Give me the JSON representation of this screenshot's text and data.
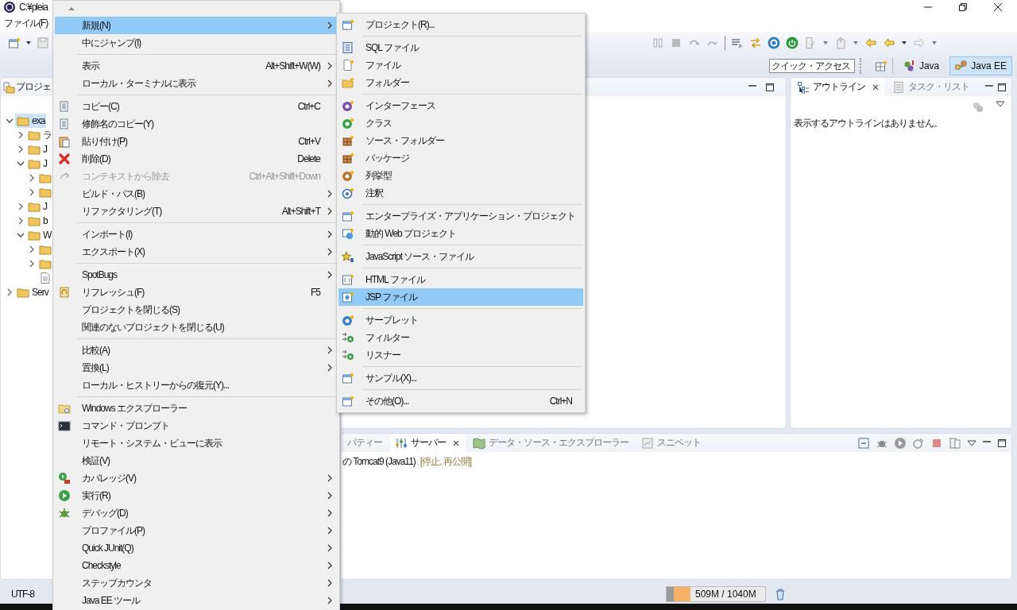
{
  "window": {
    "title": "C:¥pleia"
  },
  "menu_bar": [
    "ファイル(F)"
  ],
  "quick_access": {
    "placeholder": "クイック・アクセス"
  },
  "perspectives": [
    {
      "label": "Java",
      "selected": false
    },
    {
      "label": "Java EE",
      "selected": true
    }
  ],
  "project_explorer": {
    "title": "プロジェ",
    "tree": [
      {
        "label": "exa",
        "expanded": true,
        "selected": true,
        "children": [
          {
            "label": "ラ",
            "expanded": false,
            "selected": false
          },
          {
            "label": "J",
            "expanded": false,
            "selected": false
          },
          {
            "label": "J",
            "expanded": true,
            "selected": false,
            "children": [
              {
                "expanded": false,
                "selected": false
              },
              {
                "expanded": false,
                "selected": false
              }
            ]
          },
          {
            "label": "J",
            "expanded": false,
            "selected": false
          },
          {
            "label": "b",
            "expanded": false,
            "selected": false
          },
          {
            "label": "W",
            "expanded": true,
            "selected": false,
            "children": [
              {
                "expanded": false,
                "selected": false
              },
              {
                "expanded": false,
                "selected": false
              },
              {
                "selected": false
              }
            ]
          }
        ]
      },
      {
        "label": "Serv",
        "expanded": false,
        "selected": false
      }
    ]
  },
  "context_menu": {
    "items": [
      {
        "kind": "item",
        "label": "新規(N)",
        "submenu": true,
        "selected": true,
        "disabled": false
      },
      {
        "kind": "item",
        "label": "中にジャンプ(I)",
        "submenu": false,
        "selected": false,
        "disabled": false
      },
      {
        "kind": "separator"
      },
      {
        "kind": "item",
        "label": "表示",
        "shortcut": "Alt+Shift+W(W)",
        "submenu": true,
        "selected": false,
        "disabled": false
      },
      {
        "kind": "item",
        "label": "ローカル・ターミナルに表示",
        "submenu": true,
        "selected": false,
        "disabled": false
      },
      {
        "kind": "separator"
      },
      {
        "kind": "item",
        "label": "コピー(C)",
        "shortcut": "Ctrl+C",
        "submenu": false,
        "selected": false,
        "disabled": false
      },
      {
        "kind": "item",
        "label": "修飾名のコピー(Y)",
        "submenu": false,
        "selected": false,
        "disabled": false
      },
      {
        "kind": "item",
        "label": "貼り付け(P)",
        "shortcut": "Ctrl+V",
        "submenu": false,
        "selected": false,
        "disabled": false
      },
      {
        "kind": "item",
        "label": "削除(D)",
        "shortcut": "Delete",
        "submenu": false,
        "selected": false,
        "disabled": false
      },
      {
        "kind": "item",
        "label": "コンテキストから除去",
        "shortcut": "Ctrl+Alt+Shift+Down",
        "submenu": false,
        "selected": false,
        "disabled": true
      },
      {
        "kind": "item",
        "label": "ビルド・パス(B)",
        "submenu": true,
        "selected": false,
        "disabled": false
      },
      {
        "kind": "item",
        "label": "リファクタリング(T)",
        "shortcut": "Alt+Shift+T",
        "submenu": true,
        "selected": false,
        "disabled": false
      },
      {
        "kind": "separator"
      },
      {
        "kind": "item",
        "label": "インポート(I)",
        "submenu": true,
        "selected": false,
        "disabled": false
      },
      {
        "kind": "item",
        "label": "エクスポート(X)",
        "submenu": true,
        "selected": false,
        "disabled": false
      },
      {
        "kind": "separator"
      },
      {
        "kind": "item",
        "label": "SpotBugs",
        "submenu": true,
        "selected": false,
        "disabled": false
      },
      {
        "kind": "item",
        "label": "リフレッシュ(F)",
        "shortcut": "F5",
        "submenu": false,
        "selected": false,
        "disabled": false
      },
      {
        "kind": "item",
        "label": "プロジェクトを閉じる(S)",
        "submenu": false,
        "selected": false,
        "disabled": false
      },
      {
        "kind": "item",
        "label": "関連のないプロジェクトを閉じる(U)",
        "submenu": false,
        "selected": false,
        "disabled": false
      },
      {
        "kind": "separator"
      },
      {
        "kind": "item",
        "label": "比較(A)",
        "submenu": true,
        "selected": false,
        "disabled": false
      },
      {
        "kind": "item",
        "label": "置換(L)",
        "submenu": true,
        "selected": false,
        "disabled": false
      },
      {
        "kind": "item",
        "label": "ローカル・ヒストリーからの復元(Y)...",
        "submenu": false,
        "selected": false,
        "disabled": false
      },
      {
        "kind": "separator"
      },
      {
        "kind": "item",
        "label": "Windows エクスプローラー",
        "submenu": false,
        "selected": false,
        "disabled": false
      },
      {
        "kind": "item",
        "label": "コマンド・プロンプト",
        "submenu": false,
        "selected": false,
        "disabled": false
      },
      {
        "kind": "item",
        "label": "リモート・システム・ビューに表示",
        "submenu": false,
        "selected": false,
        "disabled": false
      },
      {
        "kind": "item",
        "label": "検証(V)",
        "submenu": false,
        "selected": false,
        "disabled": false
      },
      {
        "kind": "item",
        "label": "カバレッジ(V)",
        "submenu": true,
        "selected": false,
        "disabled": false
      },
      {
        "kind": "item",
        "label": "実行(R)",
        "submenu": true,
        "selected": false,
        "disabled": false
      },
      {
        "kind": "item",
        "label": "デバッグ(D)",
        "submenu": true,
        "selected": false,
        "disabled": false
      },
      {
        "kind": "item",
        "label": "プロファイル(P)",
        "submenu": true,
        "selected": false,
        "disabled": false
      },
      {
        "kind": "item",
        "label": "Quick JUnit(Q)",
        "submenu": true,
        "selected": false,
        "disabled": false
      },
      {
        "kind": "item",
        "label": "Checkstyle",
        "submenu": true,
        "selected": false,
        "disabled": false
      },
      {
        "kind": "item",
        "label": "ステップカウンタ",
        "submenu": true,
        "selected": false,
        "disabled": false
      },
      {
        "kind": "item",
        "label": "Java EE ツール",
        "submenu": true,
        "selected": false,
        "disabled": false
      }
    ]
  },
  "submenu": {
    "items": [
      {
        "kind": "item",
        "label": "プロジェクト(R)...",
        "selected": false
      },
      {
        "kind": "separator"
      },
      {
        "kind": "item",
        "label": "SQL ファイル",
        "selected": false
      },
      {
        "kind": "item",
        "label": "ファイル",
        "selected": false
      },
      {
        "kind": "item",
        "label": "フォルダー",
        "selected": false
      },
      {
        "kind": "separator"
      },
      {
        "kind": "item",
        "label": "インターフェース",
        "selected": false
      },
      {
        "kind": "item",
        "label": "クラス",
        "selected": false
      },
      {
        "kind": "item",
        "label": "ソース・フォルダー",
        "selected": false
      },
      {
        "kind": "item",
        "label": "パッケージ",
        "selected": false
      },
      {
        "kind": "item",
        "label": "列挙型",
        "selected": false
      },
      {
        "kind": "item",
        "label": "注釈",
        "selected": false
      },
      {
        "kind": "separator"
      },
      {
        "kind": "item",
        "label": "エンタープライズ・アプリケーション・プロジェクト",
        "selected": false
      },
      {
        "kind": "item",
        "label": "動的 Web プロジェクト",
        "selected": false
      },
      {
        "kind": "separator"
      },
      {
        "kind": "item",
        "label": "JavaScript ソース・ファイル",
        "selected": false
      },
      {
        "kind": "separator"
      },
      {
        "kind": "item",
        "label": "HTML ファイル",
        "selected": false
      },
      {
        "kind": "item",
        "label": "JSP ファイル",
        "selected": true
      },
      {
        "kind": "separator"
      },
      {
        "kind": "item",
        "label": "サーブレット",
        "selected": false
      },
      {
        "kind": "item",
        "label": "フィルター",
        "selected": false
      },
      {
        "kind": "item",
        "label": "リスナー",
        "selected": false
      },
      {
        "kind": "separator"
      },
      {
        "kind": "item",
        "label": "サンプル(X)...",
        "selected": false
      },
      {
        "kind": "separator"
      },
      {
        "kind": "item",
        "label": "その他(O)...",
        "shortcut": "Ctrl+N",
        "selected": false
      }
    ]
  },
  "outline": {
    "tabs": [
      {
        "label": "アウトライン",
        "selected": true
      },
      {
        "label": "タスク・リスト",
        "selected": false
      }
    ],
    "message": "表示するアウトラインはありません。"
  },
  "servers": {
    "tabs": [
      {
        "label": "パティー",
        "selected": false
      },
      {
        "label": "サーバー",
        "selected": true
      },
      {
        "label": "データ・ソース・エクスプローラー",
        "selected": false
      },
      {
        "label": "スニペット",
        "selected": false
      }
    ],
    "rows": [
      {
        "name": "の Tomcat9 (Java11)",
        "status": "[停止, 再公開]"
      }
    ]
  },
  "status_bar": {
    "encoding": "UTF-8",
    "heap": {
      "reading": "509M / 1040M",
      "level": 0.24
    }
  }
}
